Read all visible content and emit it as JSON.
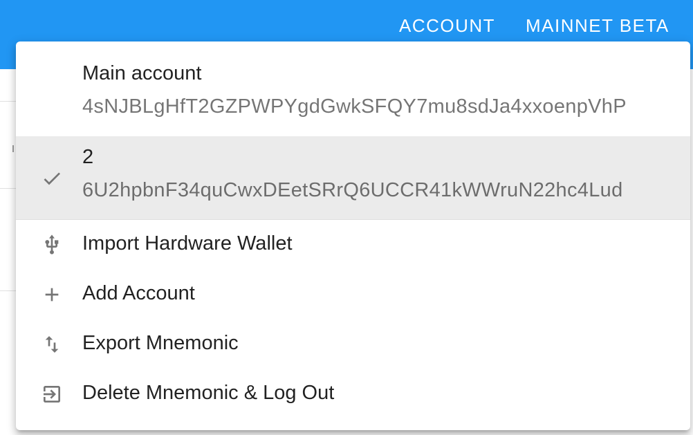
{
  "appbar": {
    "account_label": "ACCOUNT",
    "network_label": "MAINNET BETA",
    "color": "#2196f3"
  },
  "menu": {
    "accounts": [
      {
        "name": "Main account",
        "address": "4sNJBLgHfT2GZPWPYgdGwkSFQY7mu8sdJa4xxoenpVhP",
        "selected": false
      },
      {
        "name": "2",
        "address": "6U2hpbnF34quCwxDEetSRrQ6UCCR41kWWruN22hc4Lud",
        "selected": true,
        "icon": "check-icon"
      }
    ],
    "actions": [
      {
        "label": "Import Hardware Wallet",
        "icon": "usb-icon"
      },
      {
        "label": "Add Account",
        "icon": "add-icon"
      },
      {
        "label": "Export Mnemonic",
        "icon": "import-export-icon"
      },
      {
        "label": "Delete Mnemonic & Log Out",
        "icon": "exit-to-app-icon"
      }
    ]
  }
}
